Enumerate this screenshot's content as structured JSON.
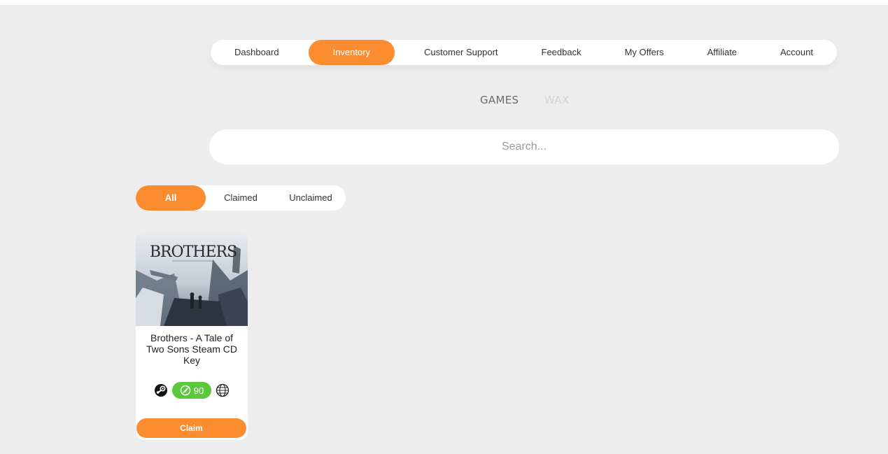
{
  "colors": {
    "accent": "#fb8c2f",
    "rating": "#5bc83c",
    "background": "#ededed"
  },
  "nav": {
    "items": [
      {
        "label": "Dashboard"
      },
      {
        "label": "Inventory",
        "active": true
      },
      {
        "label": "Customer Support"
      },
      {
        "label": "Feedback"
      },
      {
        "label": "My Offers"
      },
      {
        "label": "Affiliate"
      },
      {
        "label": "Account"
      }
    ]
  },
  "switcher": {
    "games": "GAMES",
    "wax": "WAX",
    "active": "games"
  },
  "search": {
    "placeholder": "Search...",
    "value": ""
  },
  "filters": {
    "items": [
      {
        "label": "All",
        "active": true
      },
      {
        "label": "Claimed"
      },
      {
        "label": "Unclaimed"
      }
    ]
  },
  "card": {
    "image_logo_text": "BROTHERS",
    "title": "Brothers - A Tale of Two Sons Steam CD Key",
    "platform_icon": "steam-icon",
    "rating_icon": "rating-icon",
    "rating_value": "90",
    "region_icon": "globe-icon",
    "claim_label": "Claim"
  }
}
